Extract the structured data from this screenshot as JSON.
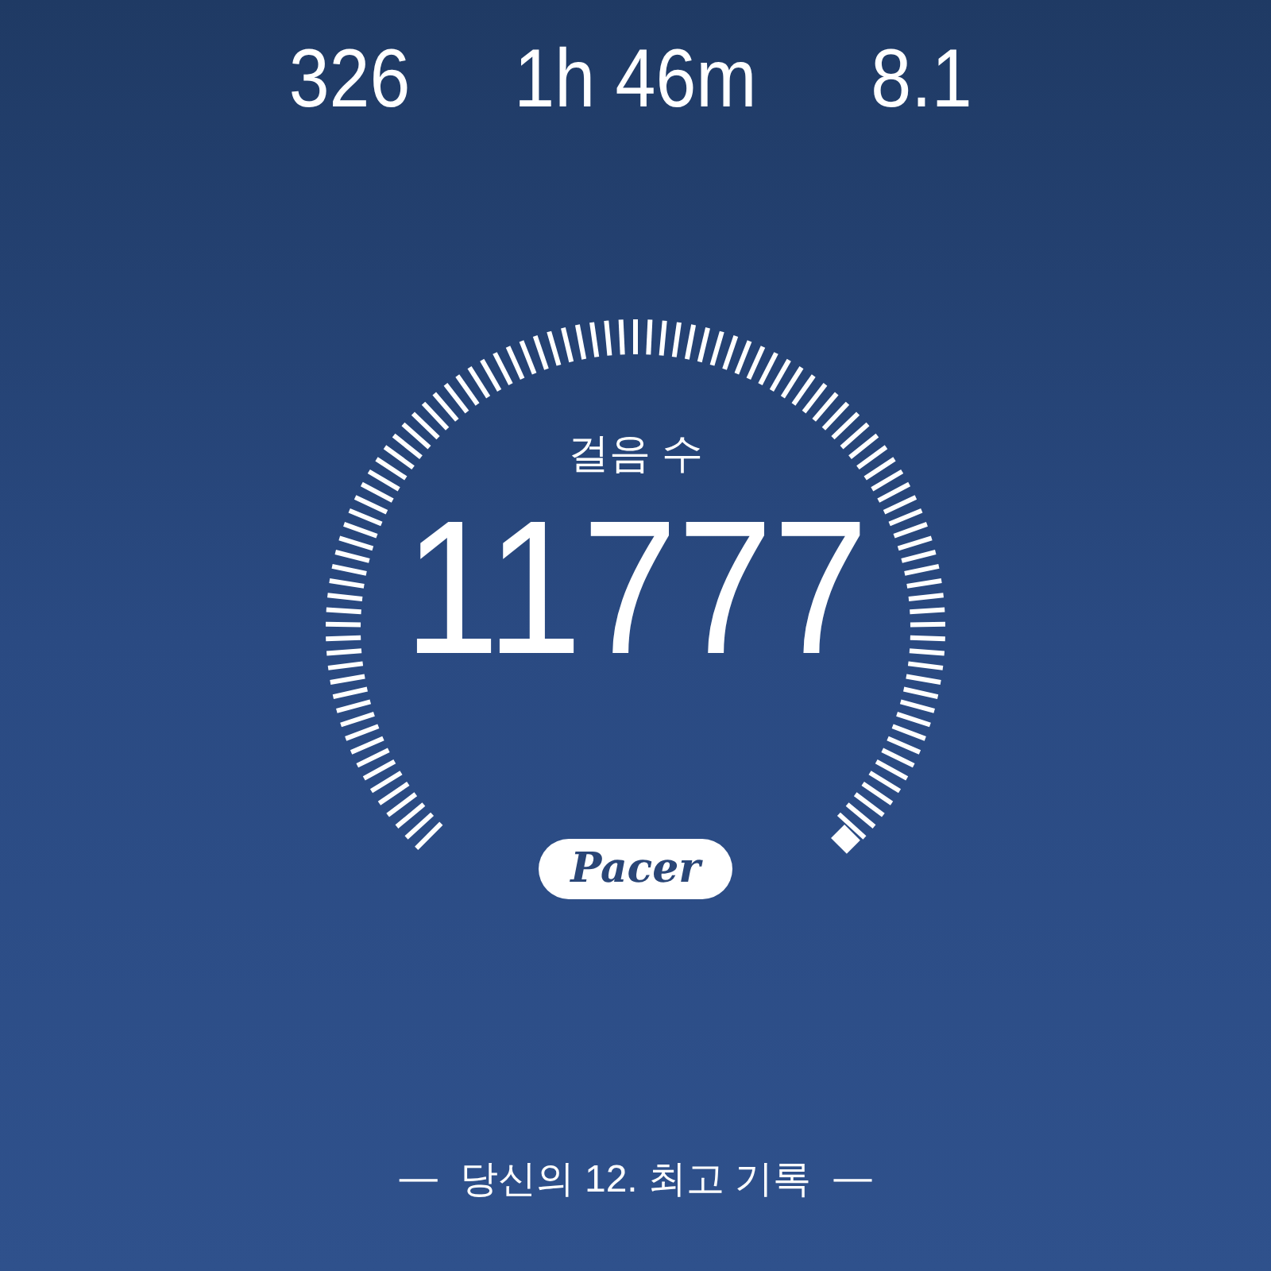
{
  "stats": [
    {
      "value": "326"
    },
    {
      "value": "1h 46m"
    },
    {
      "value": "8.1"
    }
  ],
  "gauge": {
    "label": "걸음 수",
    "value": "11777",
    "brand": "Pacer"
  },
  "footer": {
    "dash": "—",
    "text": "당신의 12. 최고 기록"
  }
}
